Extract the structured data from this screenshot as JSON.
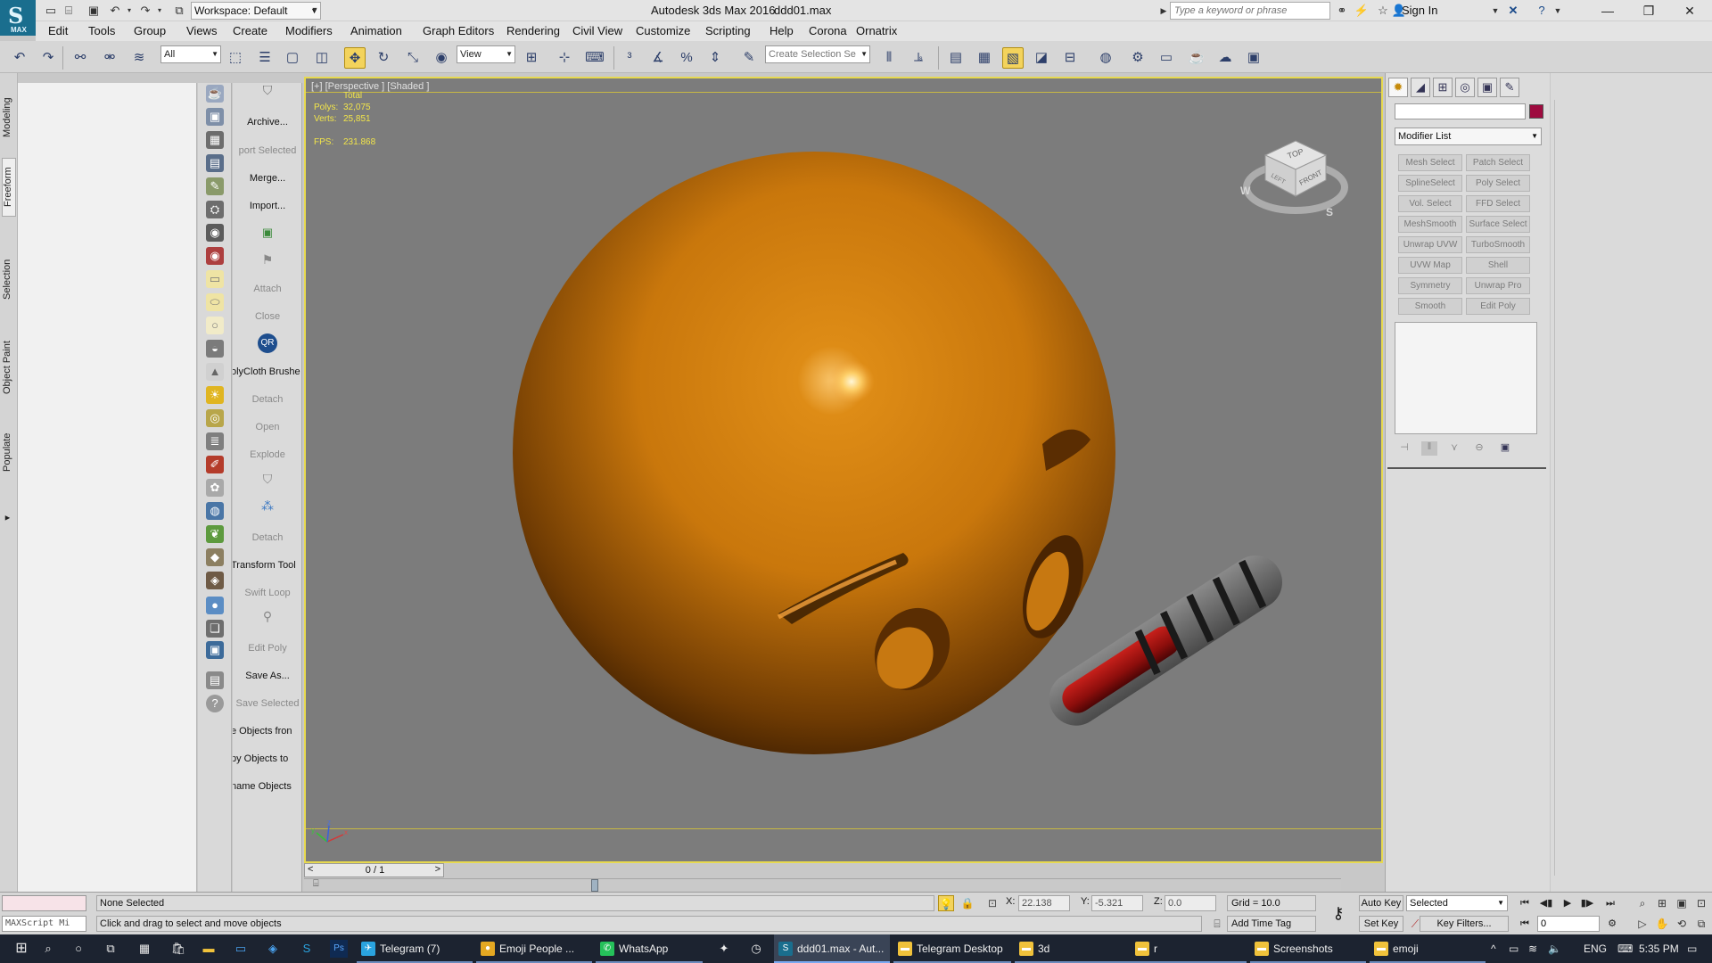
{
  "titlebar": {
    "workspace": "Workspace: Default",
    "app_title": "Autodesk 3ds Max 2016",
    "file_title": "ddd01.max",
    "search_placeholder": "Type a keyword or phrase",
    "sign_in": "Sign In",
    "logo_text": "MAX"
  },
  "menu": [
    "Edit",
    "Tools",
    "Group",
    "Views",
    "Create",
    "Modifiers",
    "Animation",
    "Graph Editors",
    "Rendering",
    "Civil View",
    "Customize",
    "Scripting",
    "Help",
    "Corona",
    "Ornatrix"
  ],
  "toolbar": {
    "filter": "All",
    "ref_coord": "View",
    "selection_set_placeholder": "Create Selection Se"
  },
  "ribbon_tabs": [
    "Modeling",
    "Freeform",
    "Selection",
    "Object Paint",
    "Populate"
  ],
  "labels_column": [
    {
      "text": "Archive...",
      "dim": false
    },
    {
      "text": "port Selected",
      "dim": true
    },
    {
      "text": "Merge...",
      "dim": false
    },
    {
      "text": "Import...",
      "dim": false
    },
    {
      "text": "Attach",
      "dim": true
    },
    {
      "text": "Close",
      "dim": true
    },
    {
      "text": "olyCloth Brushe",
      "dim": false
    },
    {
      "text": "Detach",
      "dim": true
    },
    {
      "text": "Open",
      "dim": true
    },
    {
      "text": "Explode",
      "dim": true
    },
    {
      "text": "Detach",
      "dim": true
    },
    {
      "text": "Transform Tool",
      "dim": false
    },
    {
      "text": "Swift Loop",
      "dim": true
    },
    {
      "text": "Edit Poly",
      "dim": true
    },
    {
      "text": "Save As...",
      "dim": false
    },
    {
      "text": "Save Selected",
      "dim": true
    },
    {
      "text": "e Objects fron",
      "dim": false
    },
    {
      "text": "py Objects to",
      "dim": false
    },
    {
      "text": "name Objects",
      "dim": false
    }
  ],
  "viewport": {
    "label": "[+] [Perspective ] [Shaded ]",
    "stats_header": "Total",
    "polys_label": "Polys:",
    "polys_value": "32,075",
    "verts_label": "Verts:",
    "verts_value": "25,851",
    "fps_label": "FPS:",
    "fps_value": "231.868",
    "viewcube_top": "TOP",
    "viewcube_front": "FRONT",
    "viewcube_left": "LEFT",
    "compass_w": "W",
    "compass_s": "S",
    "axis_x": "x",
    "axis_y": "y",
    "axis_z": "z"
  },
  "timeline": {
    "frame_counter": "0 / 1",
    "prev": "<",
    "next": ">"
  },
  "command_panel": {
    "modifier_list": "Modifier List",
    "object_color": "#9e0b3f",
    "modifiers": [
      [
        "Mesh Select",
        "Patch Select"
      ],
      [
        "SplineSelect",
        "Poly Select"
      ],
      [
        "Vol. Select",
        "FFD Select"
      ],
      [
        "MeshSmooth",
        "Surface Select"
      ],
      [
        "Unwrap UVW",
        "TurboSmooth"
      ],
      [
        "UVW Map",
        "Shell"
      ],
      [
        "Symmetry",
        "Unwrap Pro"
      ],
      [
        "Smooth",
        "Edit Poly"
      ]
    ]
  },
  "status": {
    "maxscript": "MAXScript Mi",
    "selection": "None Selected",
    "prompt": "Click and drag to select and move objects",
    "x_label": "X:",
    "x_value": "22.138",
    "y_label": "Y:",
    "y_value": "-5.321",
    "z_label": "Z:",
    "z_value": "0.0",
    "grid": "Grid = 10.0",
    "add_time_tag": "Add Time Tag",
    "auto_key": "Auto Key",
    "set_key": "Set Key",
    "selected": "Selected",
    "key_filters": "Key Filters...",
    "frame": "0"
  },
  "taskbar": {
    "apps": [
      {
        "label": "Telegram (7)",
        "color": "#2aa3df",
        "glyph": "✈"
      },
      {
        "label": "Emoji People ...",
        "color": "#e4a822",
        "glyph": "●"
      },
      {
        "label": "WhatsApp",
        "color": "#25c15a",
        "glyph": "✆"
      },
      {
        "label": "ddd01.max - Aut...",
        "color": "#1a6e8e",
        "glyph": "S"
      },
      {
        "label": "Telegram Desktop",
        "color": "#f0c23b",
        "glyph": "▬"
      },
      {
        "label": "3d",
        "color": "#f0c23b",
        "glyph": "▬"
      },
      {
        "label": "r",
        "color": "#f0c23b",
        "glyph": "▬"
      },
      {
        "label": "Screenshots",
        "color": "#f0c23b",
        "glyph": "▬"
      },
      {
        "label": "emoji",
        "color": "#f0c23b",
        "glyph": "▬"
      }
    ],
    "lang": "ENG",
    "time": "5:35 PM"
  }
}
